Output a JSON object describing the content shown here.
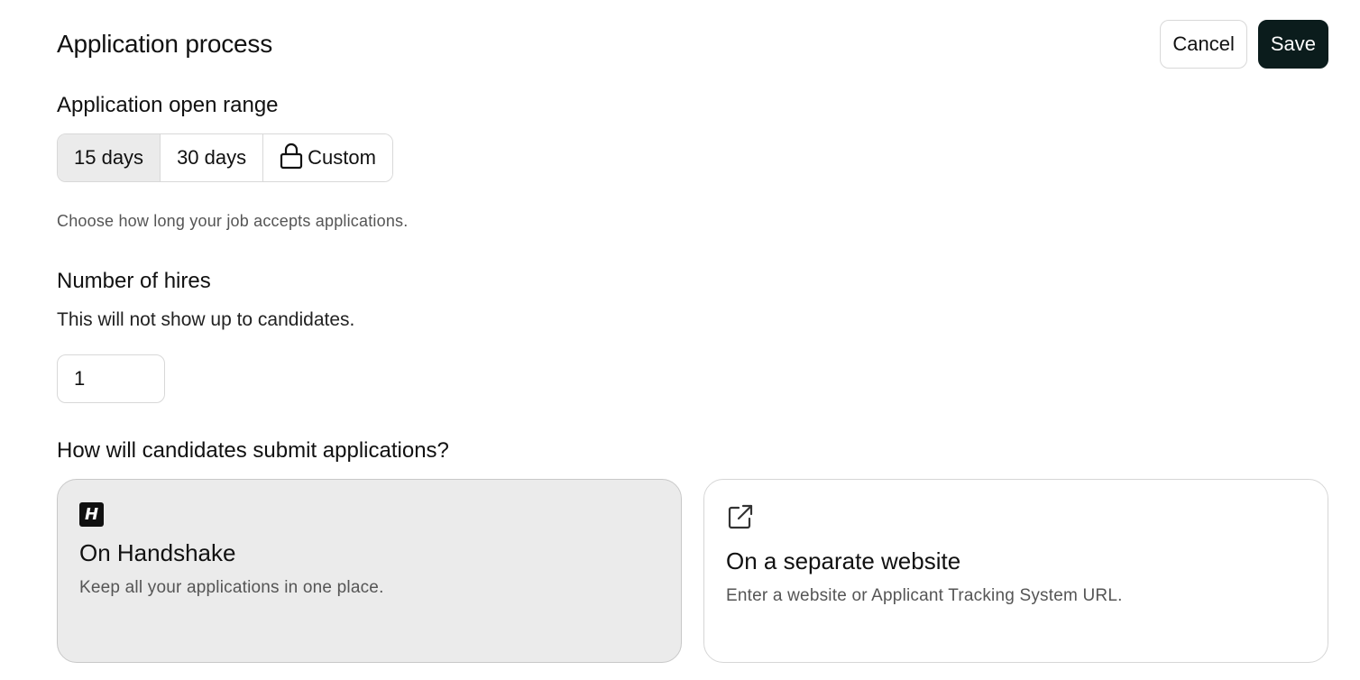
{
  "header": {
    "title": "Application process",
    "cancel_label": "Cancel",
    "save_label": "Save"
  },
  "open_range": {
    "title": "Application open range",
    "options": [
      {
        "label": "15 days",
        "selected": true
      },
      {
        "label": "30 days",
        "selected": false
      },
      {
        "label": "Custom",
        "selected": false,
        "icon": "lock-icon"
      }
    ],
    "helper": "Choose how long your job accepts applications."
  },
  "hires": {
    "title": "Number of hires",
    "subtitle": "This will not show up to candidates.",
    "value": "1"
  },
  "submission": {
    "title": "How will candidates submit applications?",
    "options": [
      {
        "icon": "handshake-logo-icon",
        "logo_letter": "H",
        "title": "On Handshake",
        "description": "Keep all your applications in one place.",
        "selected": true
      },
      {
        "icon": "external-link-icon",
        "title": "On a separate website",
        "description": "Enter a website or Applicant Tracking System URL.",
        "selected": false
      }
    ]
  },
  "colors": {
    "primary_button": "#0b1c1c",
    "selected_bg": "#ebebeb",
    "border": "#d8d8d8"
  }
}
